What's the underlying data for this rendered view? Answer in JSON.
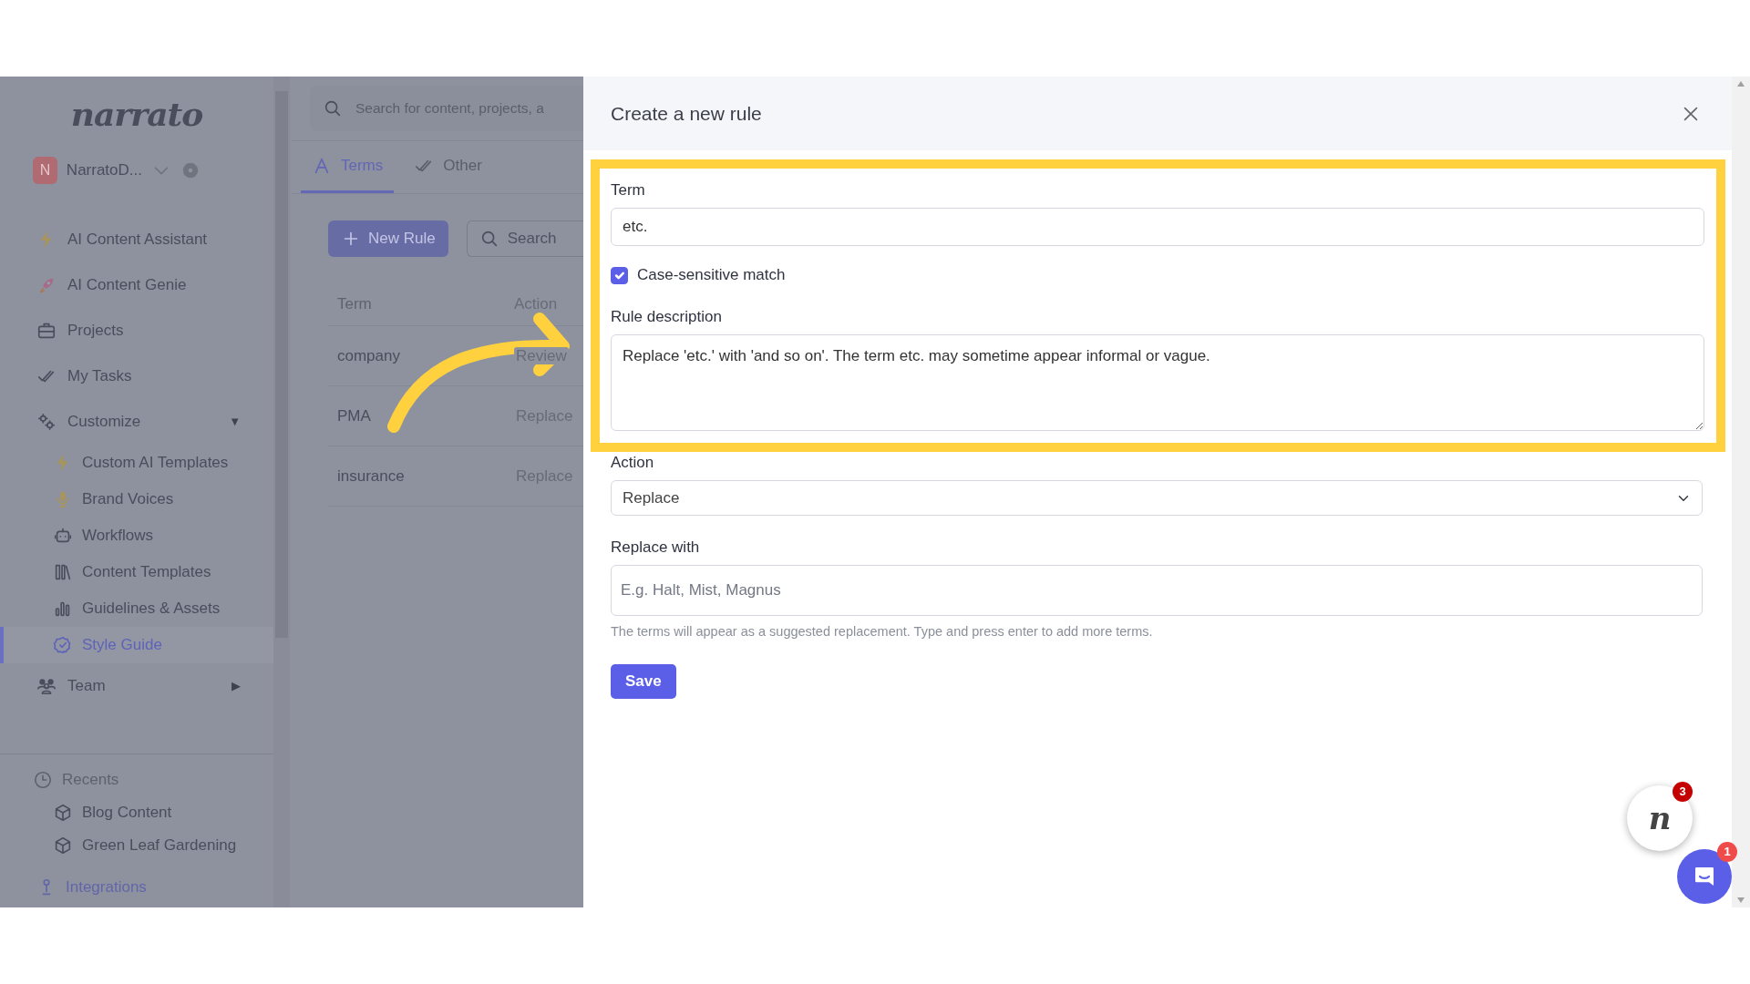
{
  "sidebar": {
    "logo": "narrato",
    "workspace": {
      "initial": "N",
      "name": "NarratoD..."
    },
    "items": [
      {
        "label": "AI Content Assistant",
        "selected": false
      },
      {
        "label": "AI Content Genie",
        "selected": false
      },
      {
        "label": "Projects",
        "selected": false
      },
      {
        "label": "My Tasks",
        "selected": false
      },
      {
        "label": "Customize",
        "caret": "▼",
        "selected": false,
        "children": [
          {
            "label": "Custom AI Templates",
            "selected": false
          },
          {
            "label": "Brand Voices",
            "selected": false
          },
          {
            "label": "Workflows",
            "selected": false
          },
          {
            "label": "Content Templates",
            "selected": false
          },
          {
            "label": "Guidelines & Assets",
            "selected": false
          },
          {
            "label": "Style Guide",
            "selected": true
          }
        ]
      },
      {
        "label": "Team",
        "caret": "▶",
        "selected": false
      }
    ],
    "recents": {
      "title": "Recents",
      "items": [
        "Blog Content",
        "Green Leaf Gardening"
      ]
    },
    "footer_item": "Integrations"
  },
  "main": {
    "search": {
      "placeholder": "Search for content, projects, a"
    },
    "tabs": [
      {
        "label": "Terms",
        "selected": true
      },
      {
        "label": "Other",
        "selected": false
      }
    ],
    "new_rule": "New Rule",
    "table_search": {
      "placeholder": "Search"
    },
    "table": {
      "columns": [
        "Term",
        "Action"
      ],
      "rows": [
        [
          "company",
          "Review"
        ],
        [
          "PMA",
          "Replace"
        ],
        [
          "insurance",
          "Replace"
        ]
      ]
    }
  },
  "modal": {
    "title": "Create a new rule",
    "term_label": "Term",
    "term_value": "etc.",
    "case_sensitive": {
      "label": "Case-sensitive match",
      "checked": true
    },
    "description_label": "Rule description",
    "description_value": "Replace 'etc.' with 'and so on'. The term etc. may sometime appear informal or vague.",
    "action_label": "Action",
    "action_value": "Replace",
    "replace_label": "Replace with",
    "replace_placeholder": "E.g. Halt, Mist, Magnus",
    "hint": "The terms will appear as a suggested replacement. Type and press enter to add more terms.",
    "save": "Save"
  },
  "widgets": {
    "assistant_letter": "n",
    "assistant_badge": "3",
    "chat_badge": "1"
  }
}
